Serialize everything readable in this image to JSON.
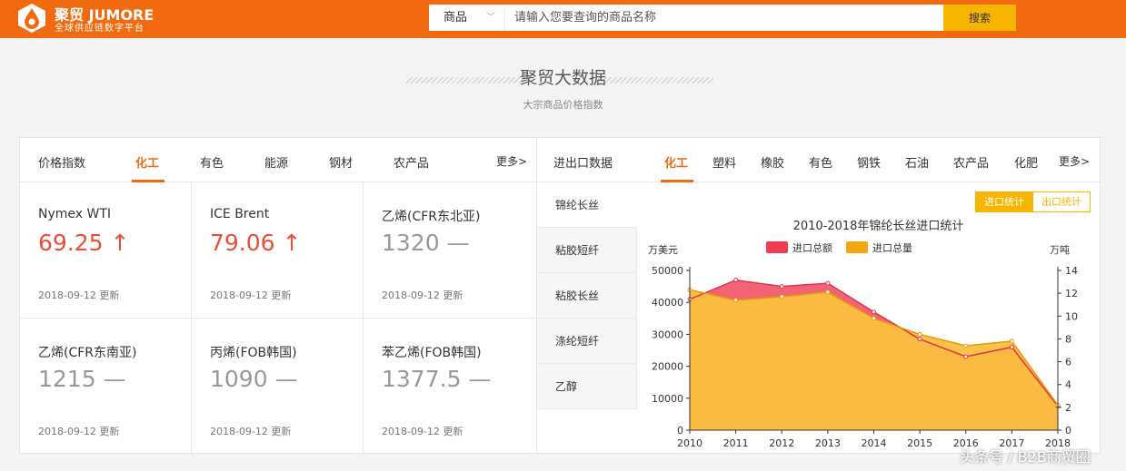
{
  "colors": {
    "brand": "#f26a0f",
    "accent": "#f7b500",
    "up": "#e8503a",
    "series_value": "#ef3c53",
    "series_volume": "#f5a70f"
  },
  "header": {
    "logo_title": "聚贸 JUMORE",
    "logo_sub": "全球供应链数字平台",
    "logo_icon": "drop-logo-icon",
    "search": {
      "category": "商品",
      "placeholder": "请输入您要查询的商品名称",
      "button": "搜索"
    }
  },
  "section": {
    "title": "聚贸大数据",
    "subtitle": "大宗商品价格指数"
  },
  "price_panel": {
    "heading": "价格指数",
    "tabs": [
      "化工",
      "有色",
      "能源",
      "钢材",
      "农产品"
    ],
    "more": "更多>",
    "items": [
      {
        "name": "Nymex WTI",
        "value": "69.25 ↑",
        "date": "2018-09-12 更新",
        "trend": "up"
      },
      {
        "name": "ICE Brent",
        "value": "79.06 ↑",
        "date": "2018-09-12 更新",
        "trend": "up"
      },
      {
        "name": "乙烯(CFR东北亚)",
        "value": "1320 —",
        "date": "2018-09-12 更新",
        "trend": "flat"
      },
      {
        "name": "乙烯(CFR东南亚)",
        "value": "1215 —",
        "date": "2018-09-12 更新",
        "trend": "flat"
      },
      {
        "name": "丙烯(FOB韩国)",
        "value": "1090 —",
        "date": "2018-09-12 更新",
        "trend": "flat"
      },
      {
        "name": "苯乙烯(FOB韩国)",
        "value": "1377.5 —",
        "date": "2018-09-12 更新",
        "trend": "flat"
      }
    ]
  },
  "trade_panel": {
    "heading": "进出口数据",
    "tabs": [
      "化工",
      "塑料",
      "橡胶",
      "有色",
      "钢铁",
      "石油",
      "农产品",
      "化肥"
    ],
    "more": "更多>",
    "products": [
      "锦纶长丝",
      "粘胶短纤",
      "粘胶长丝",
      "涤纶短纤",
      "乙醇"
    ],
    "toggle": [
      "进口统计",
      "出口统计"
    ]
  },
  "chart_data": {
    "type": "area",
    "title": "2010-2018年锦纶长丝进口统计",
    "ylabel_left": "万美元",
    "ylabel_right": "万吨",
    "legend_placement": "top-center",
    "x": [
      "2010",
      "2011",
      "2012",
      "2013",
      "2014",
      "2015",
      "2016",
      "2017",
      "2018"
    ],
    "ylim_left": [
      0,
      50000
    ],
    "yticks_left": [
      "0",
      "10000",
      "20000",
      "30000",
      "40000",
      "50000"
    ],
    "ylim_right": [
      0,
      14
    ],
    "yticks_right": [
      "0",
      "2",
      "4",
      "6",
      "8",
      "10",
      "12",
      "14"
    ],
    "series": [
      {
        "name": "进口总额",
        "axis": "left",
        "values": [
          41000,
          47000,
          45000,
          46000,
          37000,
          28500,
          23000,
          26000,
          7500
        ]
      },
      {
        "name": "进口总量",
        "axis": "right",
        "values": [
          12.3,
          11.4,
          11.7,
          12.1,
          9.8,
          8.4,
          7.4,
          7.8,
          2.2
        ]
      }
    ]
  },
  "watermark": "头条号 / B2B商贸圈"
}
